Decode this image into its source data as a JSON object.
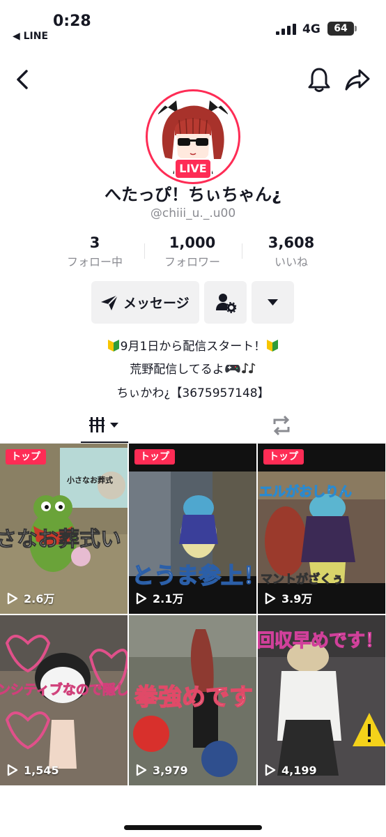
{
  "status_bar": {
    "time": "0:28",
    "back_app": "◀ LINE",
    "network": "4G",
    "battery": "64"
  },
  "profile": {
    "live_badge": "LIVE",
    "display_name": "へたっぴ！ちぃちゃん¿",
    "username": "@chiii_u._.u00"
  },
  "stats": [
    {
      "value": "3",
      "label": "フォロー中"
    },
    {
      "value": "1,000",
      "label": "フォロワー"
    },
    {
      "value": "3,608",
      "label": "いいね"
    }
  ],
  "actions": {
    "message_label": "メッセージ"
  },
  "bio": {
    "line1": "9月1日から配信スタート！",
    "line2": "荒野配信してるよ",
    "line3": "ちぃかわ¿【3675957148】",
    "icons": [
      "beginner-mark-icon",
      "game-controller-icon",
      "music-notes-icon"
    ]
  },
  "tabs": {
    "active": "videos-grid-icon",
    "other": "repost-icon"
  },
  "videos": [
    {
      "pinned": "トップ",
      "views": "2.6万",
      "overlay": "さなお葬式い",
      "sign": "小さなお葬式",
      "bg": "#8a8064"
    },
    {
      "pinned": "トップ",
      "views": "2.1万",
      "overlay": "とうま参上！",
      "bg": "#566069"
    },
    {
      "pinned": "トップ",
      "views": "3.9万",
      "overlay": "エルがおしりん",
      "overlay2": "マントがざくぅ",
      "bg": "#6d5a4c"
    },
    {
      "pinned": "",
      "views": "1,545",
      "overlay": "ンシティブなので隠し",
      "bg": "#7b6f62"
    },
    {
      "pinned": "",
      "views": "3,979",
      "overlay": "拳強めです",
      "bg": "#6f7266"
    },
    {
      "pinned": "",
      "views": "4,199",
      "overlay": "回収早めです！",
      "bg": "#4d4a4c"
    }
  ],
  "colors": {
    "accent": "#fe2c55",
    "text": "#161823",
    "muted": "#8a8b91",
    "button_bg": "#f1f1f2"
  }
}
